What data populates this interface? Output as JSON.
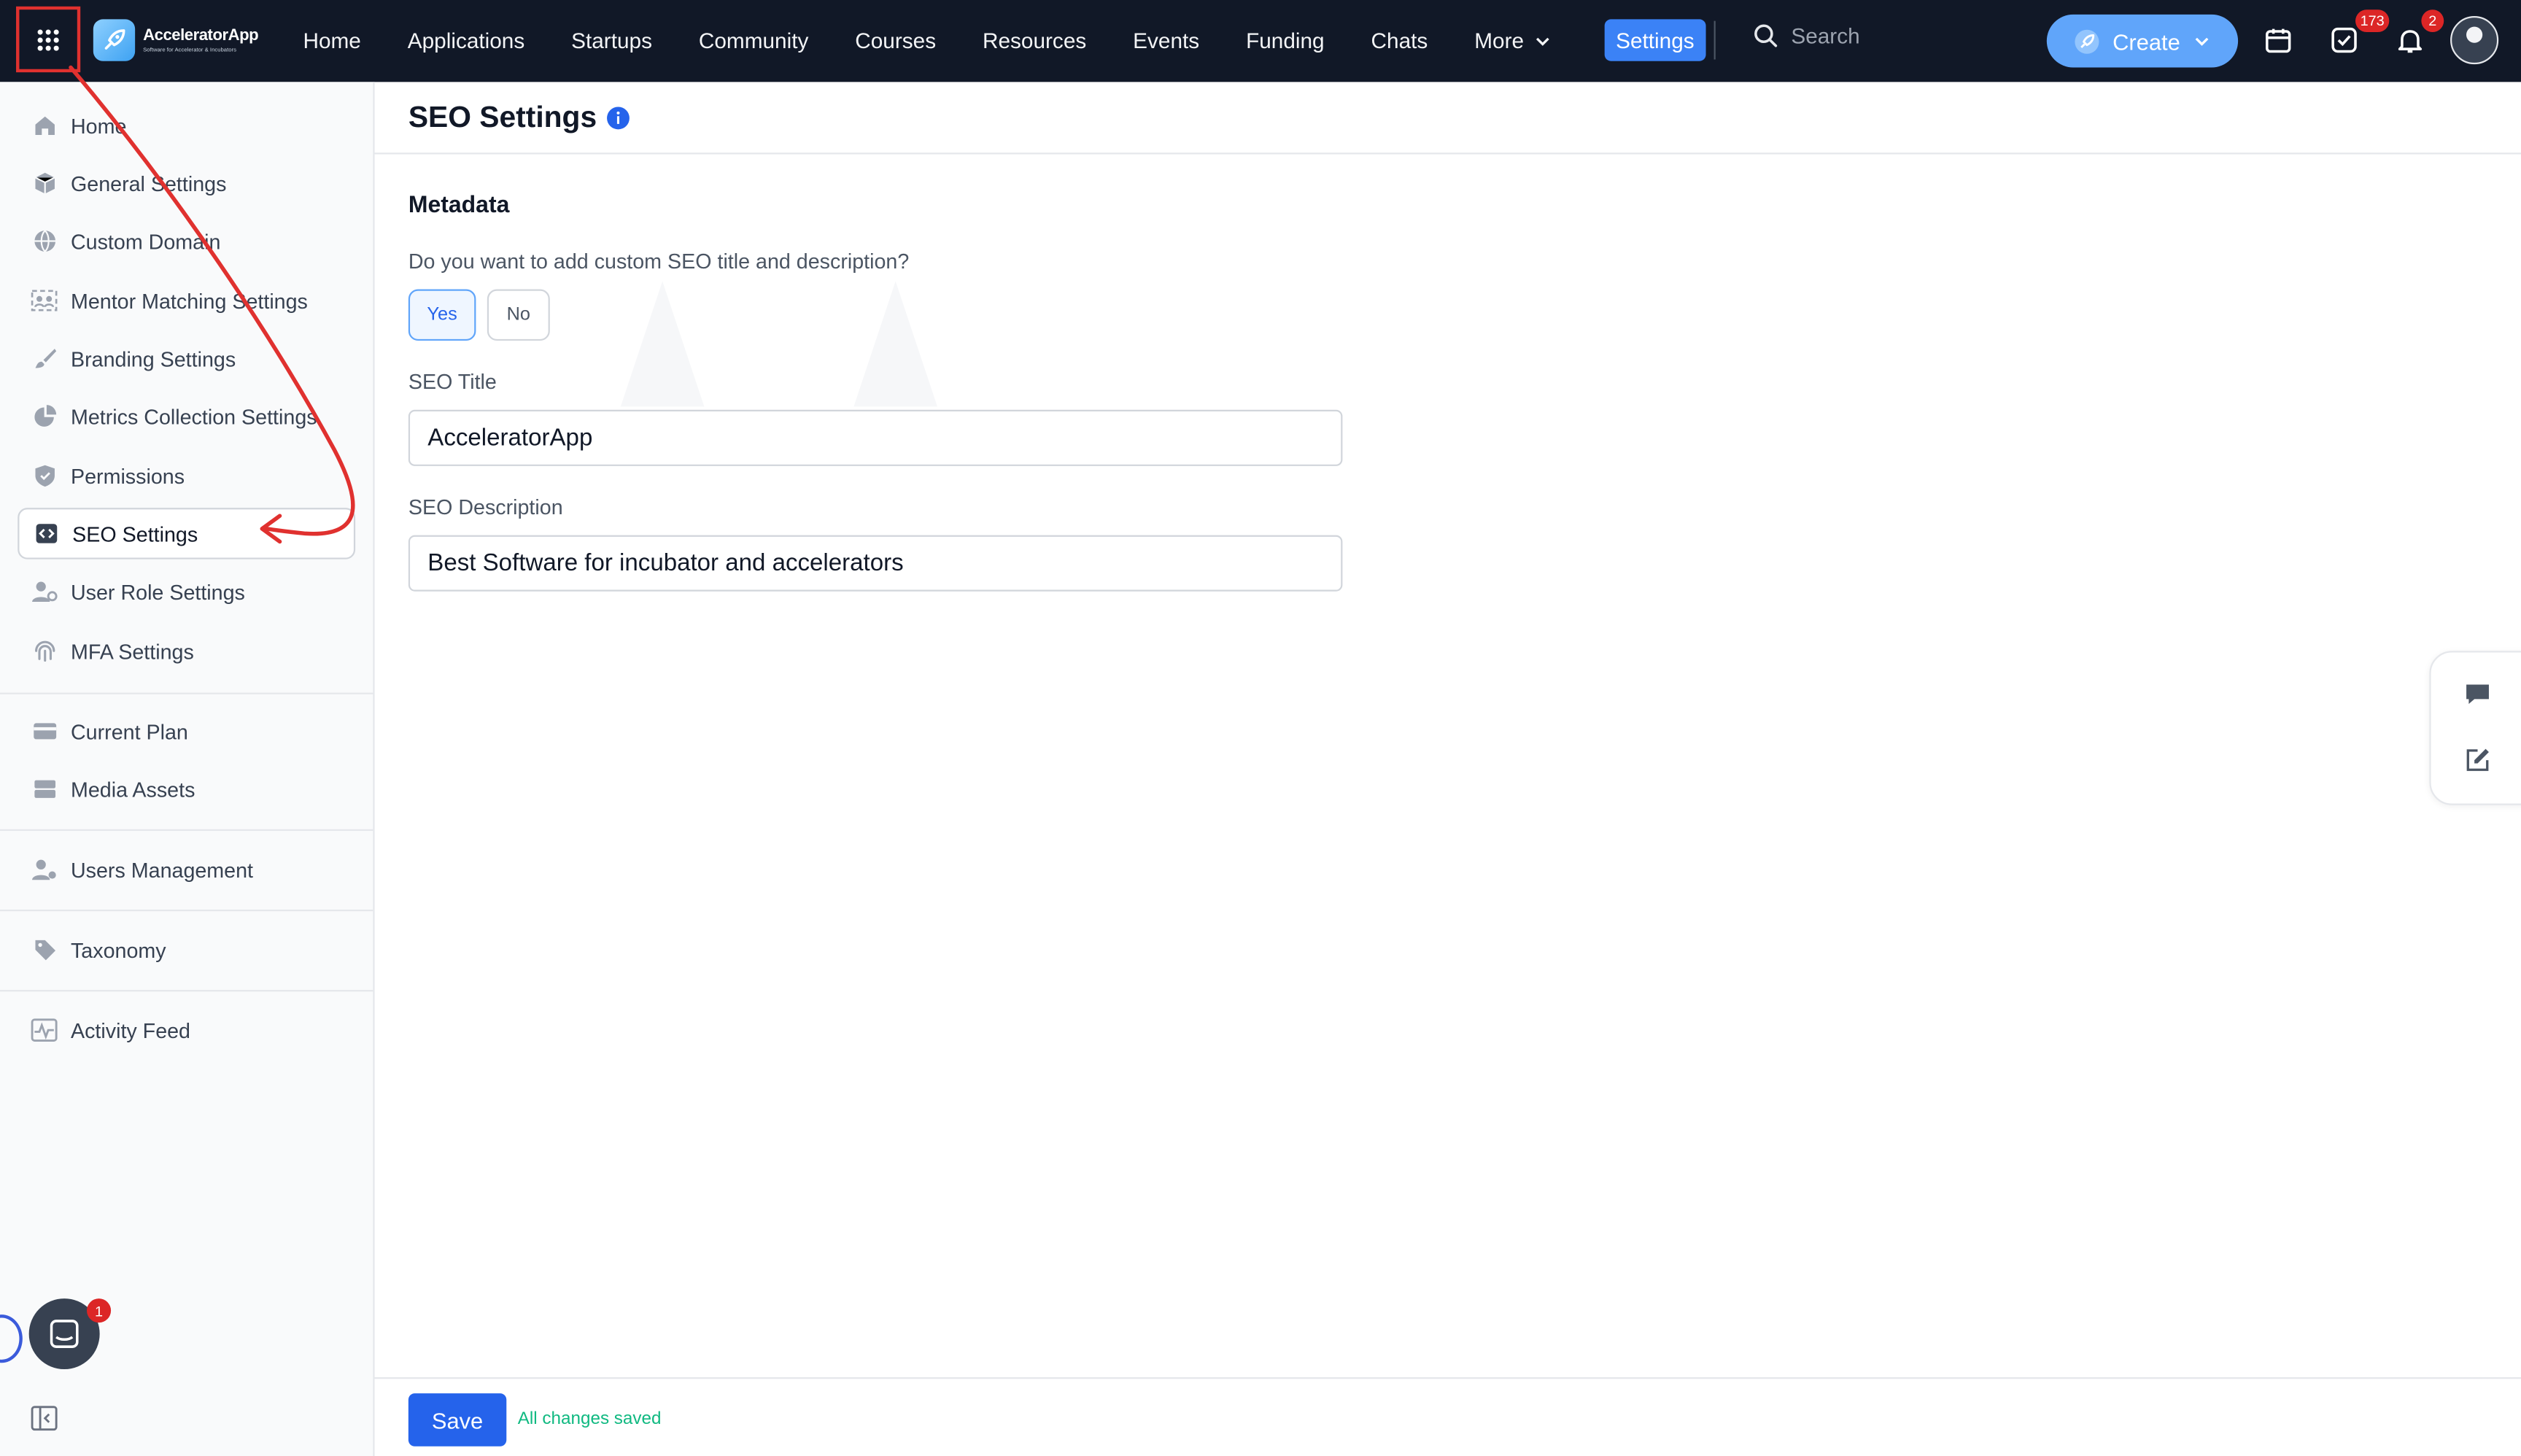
{
  "brand": {
    "name": "AcceleratorApp",
    "tagline": "Software for Accelerator & Incubators"
  },
  "nav": {
    "items": [
      "Home",
      "Applications",
      "Startups",
      "Community",
      "Courses",
      "Resources",
      "Events",
      "Funding",
      "Chats"
    ],
    "more_label": "More",
    "settings_label": "Settings",
    "search_placeholder": "Search",
    "create_label": "Create",
    "tasks_count": "173",
    "notifications_count": "2"
  },
  "sidebar": {
    "items": [
      {
        "label": "Home",
        "icon": "home-icon"
      },
      {
        "label": "General Settings",
        "icon": "cube-icon"
      },
      {
        "label": "Custom Domain",
        "icon": "globe-icon"
      },
      {
        "label": "Mentor Matching Settings",
        "icon": "people-match-icon"
      },
      {
        "label": "Branding Settings",
        "icon": "brush-icon"
      },
      {
        "label": "Metrics Collection Settings",
        "icon": "pie-chart-icon"
      },
      {
        "label": "Permissions",
        "icon": "shield-icon"
      },
      {
        "label": "SEO Settings",
        "icon": "code-icon"
      },
      {
        "label": "User Role Settings",
        "icon": "user-role-icon"
      },
      {
        "label": "MFA Settings",
        "icon": "fingerprint-icon"
      }
    ],
    "group2": [
      {
        "label": "Current Plan",
        "icon": "credit-card-icon"
      },
      {
        "label": "Media Assets",
        "icon": "server-icon"
      }
    ],
    "group3": [
      {
        "label": "Users Management",
        "icon": "users-gear-icon"
      }
    ],
    "group4": [
      {
        "label": "Taxonomy",
        "icon": "tag-icon"
      }
    ],
    "group5": [
      {
        "label": "Activity Feed",
        "icon": "activity-icon"
      }
    ],
    "active": "SEO Settings"
  },
  "page": {
    "title": "SEO Settings",
    "section_title": "Metadata",
    "question": "Do you want to add custom SEO title and description?",
    "yes_label": "Yes",
    "no_label": "No",
    "selected": "Yes",
    "seo_title_label": "SEO Title",
    "seo_title_value": "AcceleratorApp",
    "seo_description_label": "SEO Description",
    "seo_description_value": "Best Software for incubator and accelerators"
  },
  "footer": {
    "save_label": "Save",
    "status": "All changes saved"
  },
  "chat": {
    "unread_count": "1"
  },
  "colors": {
    "topbar": "#111827",
    "accent": "#2563eb",
    "annotation": "#e0312f",
    "saved_status": "#10b981"
  }
}
